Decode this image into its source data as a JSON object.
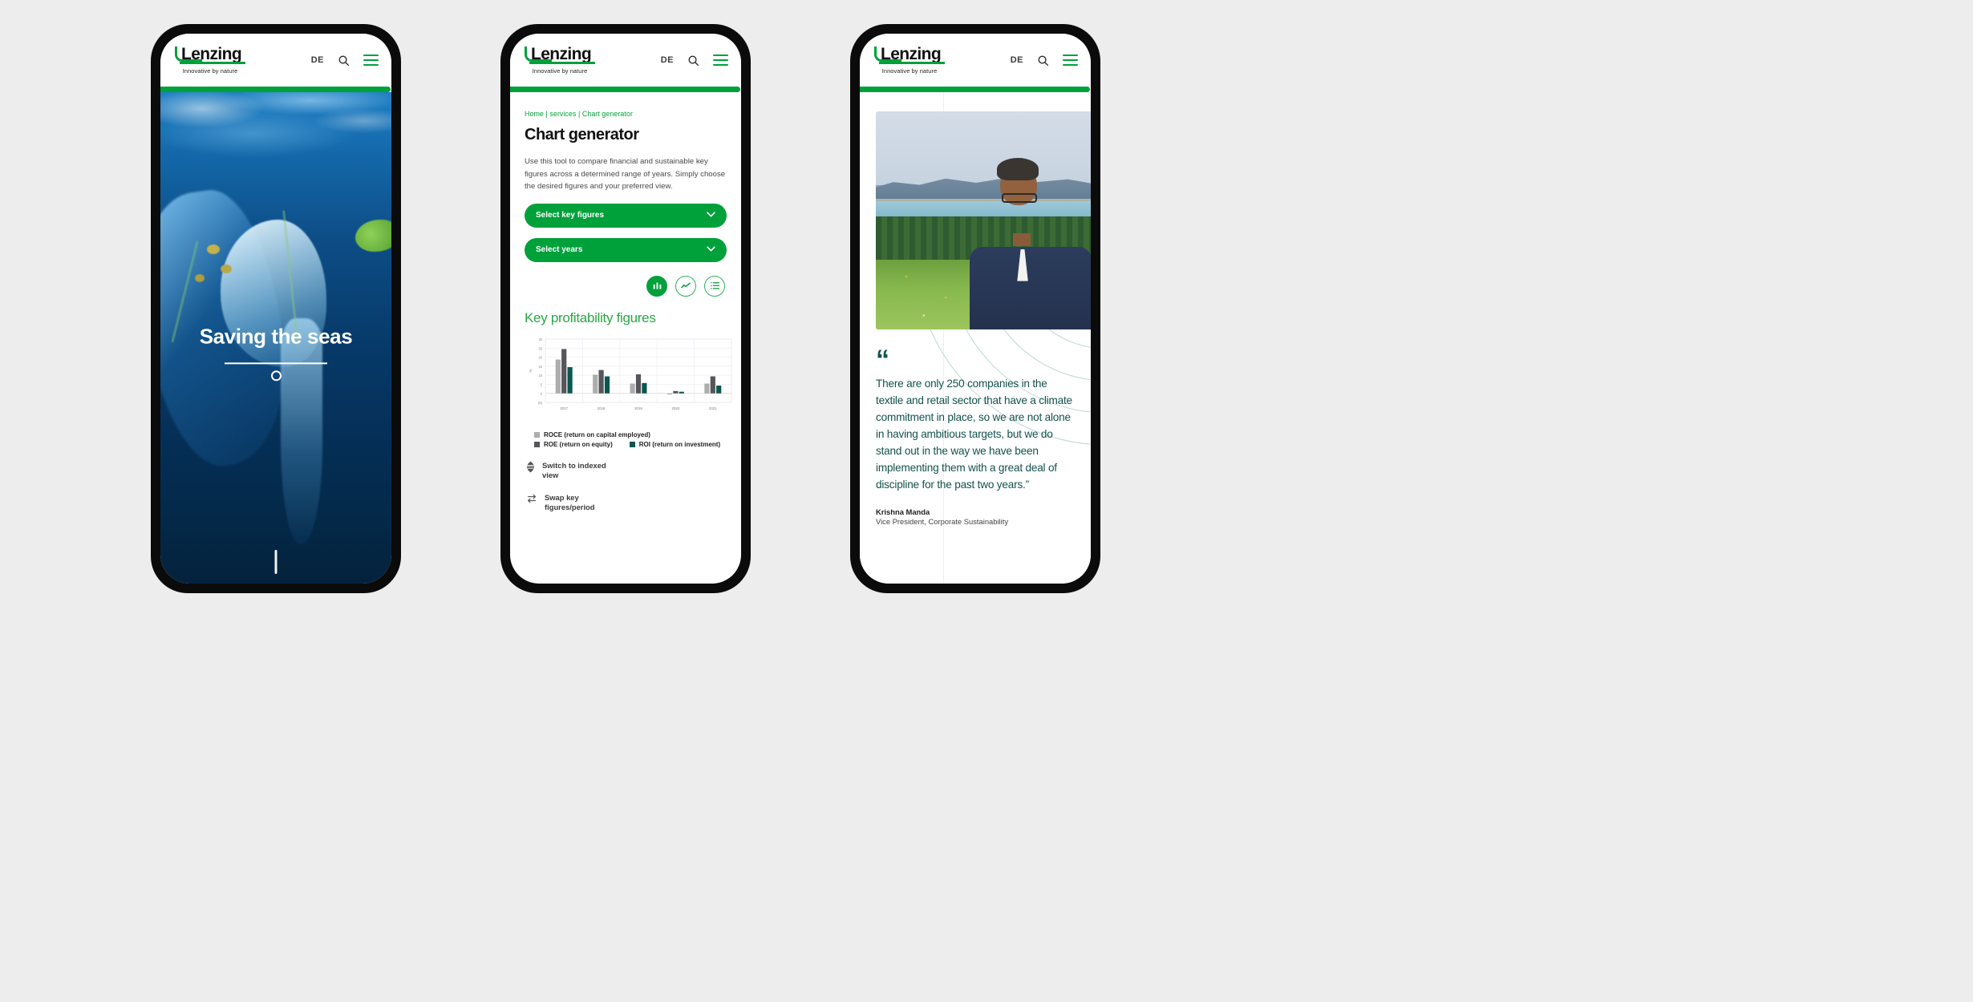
{
  "brand": {
    "logo_word": "Lenzing",
    "tagline": "Innovative by nature",
    "accent_green": "#00a03b",
    "dark_teal": "#12524d"
  },
  "header": {
    "language_label": "DE",
    "search_icon": "search-icon",
    "menu_icon": "hamburger-menu-icon"
  },
  "phone1": {
    "hero_title": "Saving the seas",
    "scroll_indicator": "vertical-scroll-line"
  },
  "phone2": {
    "breadcrumb": "Home | services | Chart generator",
    "page_title": "Chart generator",
    "intro": "Use this tool to compare financial and sustainable key figures across a determined range of years. Simply choose the desired figures and your preferred view.",
    "select_key_figures": "Select key figures",
    "select_years": "Select years",
    "view_toggles": [
      {
        "name": "bar-chart-view",
        "active": true
      },
      {
        "name": "line-chart-view",
        "active": false
      },
      {
        "name": "table-view",
        "active": false
      }
    ],
    "chart_heading": "Key profitability figures",
    "controls": [
      {
        "icon": "sort-vertical-icon",
        "label": "Switch to indexed view"
      },
      {
        "icon": "swap-horizontal-icon",
        "label": "Swap key figures/period"
      }
    ]
  },
  "phone3": {
    "quote_mark": "“",
    "quote": "There are only 250 companies in the textile and retail sector that have a climate commitment in place, so we are not alone in having ambitious targets, but we do stand out in the way we have been implementing them with a great deal of discipline for the past two years.”",
    "author_name": "Krishna Manda",
    "author_role": "Vice President, Corporate Sustainability",
    "portrait_alt": "portrait-photo"
  },
  "chart_data": {
    "type": "bar",
    "title": "Key profitability figures",
    "xlabel": "",
    "ylabel": "%",
    "categories": [
      "2017",
      "2018",
      "2019",
      "2020",
      "2021"
    ],
    "ylim": [
      -5,
      30
    ],
    "yticks": [
      30,
      25,
      20,
      15,
      10,
      5,
      0,
      -5
    ],
    "ytick_labels": [
      "30",
      "25",
      "20",
      "15",
      "10",
      "5",
      "0",
      "(5)"
    ],
    "grid": true,
    "legend_position": "bottom-left",
    "series": [
      {
        "name": "ROCE (return on capital employed)",
        "color": "#adadad",
        "values": [
          18.7,
          10.3,
          5.4,
          -0.6,
          5.4
        ]
      },
      {
        "name": "ROE (return on equity)",
        "color": "#55555b",
        "values": [
          24.5,
          12.9,
          10.5,
          1.3,
          9.4
        ]
      },
      {
        "name": "ROI (return on investment)",
        "color": "#0a5750",
        "values": [
          14.5,
          9.4,
          5.7,
          0.9,
          4.3
        ]
      }
    ]
  }
}
